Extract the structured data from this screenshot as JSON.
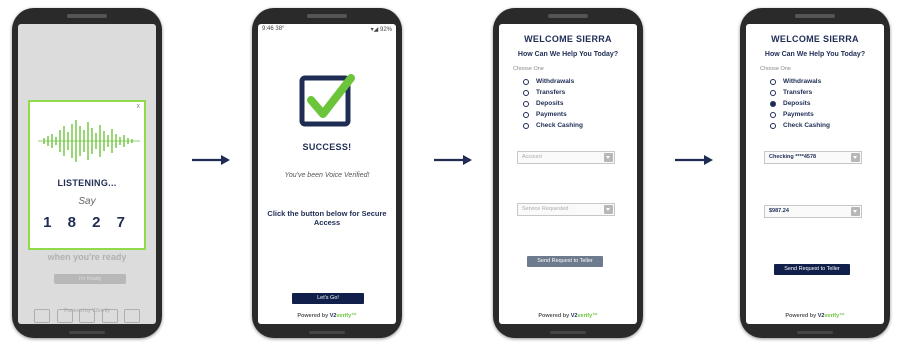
{
  "phone1": {
    "background_text": "Click the button below when you're ready",
    "background_button": "I'm Ready",
    "background_powered": "Powered by V2verify",
    "modal": {
      "close": "x",
      "listening": "LISTENING...",
      "say": "Say",
      "code": "1 8 2 7"
    }
  },
  "phone2": {
    "status_time": "9:46",
    "status_temp": "38°",
    "status_battery": "92%",
    "title": "SUCCESS!",
    "verified": "You've been Voice Verified!",
    "instruction": "Click the button below for Secure Access",
    "button": "Let's Go!",
    "powered_prefix": "Powered by ",
    "powered_v2": "V2",
    "powered_verify": "verify",
    "powered_tm": "™"
  },
  "phone3": {
    "title": "WELCOME SIERRA",
    "subtitle": "How Can We Help You Today?",
    "choose": "Choose One",
    "options": [
      "Withdrawals",
      "Transfers",
      "Deposits",
      "Payments",
      "Check Cashing"
    ],
    "account_placeholder": "Account",
    "service_placeholder": "Service Requested",
    "button": "Send Request to Teller",
    "powered_prefix": "Powered by ",
    "powered_v2": "V2",
    "powered_verify": "verify",
    "powered_tm": "™"
  },
  "phone4": {
    "title": "WELCOME SIERRA",
    "subtitle": "How Can We Help You Today?",
    "choose": "Choose One",
    "options": [
      "Withdrawals",
      "Transfers",
      "Deposits",
      "Payments",
      "Check Cashing"
    ],
    "selected_option": "Deposits",
    "account_value": "Checking ****4578",
    "amount_value": "$987.24",
    "button": "Send Request to Teller",
    "powered_prefix": "Powered by ",
    "powered_v2": "V2",
    "powered_verify": "verify",
    "powered_tm": "™"
  },
  "colors": {
    "navy": "#1f2d55",
    "accent_green": "#8fdb4a",
    "button_navy": "#10204a",
    "button_grey": "#6e7a8d"
  }
}
